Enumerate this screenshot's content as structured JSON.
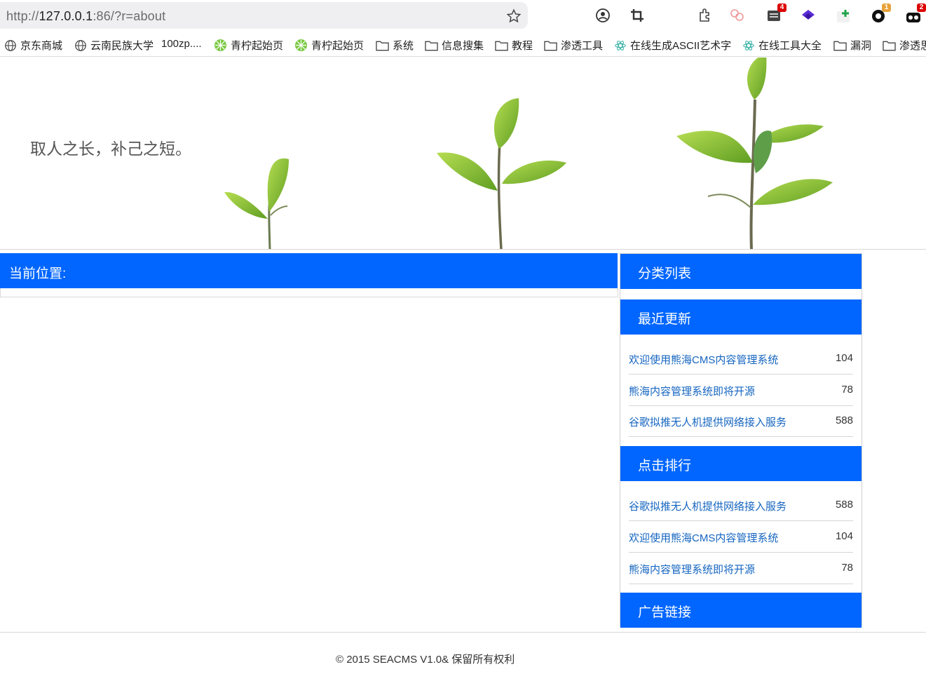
{
  "browser": {
    "url_scheme": "http://",
    "url_host": "127.0.0.1",
    "url_rest": ":86/?r=about",
    "extension_badges": [
      "4",
      "1",
      "2"
    ],
    "bookmarks": [
      "京东商城",
      "云南民族大学",
      "100zp....",
      "青柠起始页",
      "青柠起始页",
      "系统",
      "信息搜集",
      "教程",
      "渗透工具",
      "在线生成ASCII艺术字",
      "在线工具大全",
      "漏洞",
      "渗透思"
    ]
  },
  "banner": {
    "slogan": "取人之长，补己之短。"
  },
  "main": {
    "location_label": "当前位置:"
  },
  "sidebar": {
    "category_title": "分类列表",
    "recent_title": "最近更新",
    "recent": [
      {
        "title": "欢迎使用熊海CMS内容管理系统",
        "count": "104"
      },
      {
        "title": "熊海内容管理系统即将开源",
        "count": "78"
      },
      {
        "title": "谷歌拟推无人机提供网络接入服务",
        "count": "588"
      }
    ],
    "rank_title": "点击排行",
    "rank": [
      {
        "title": "谷歌拟推无人机提供网络接入服务",
        "count": "588"
      },
      {
        "title": "欢迎使用熊海CMS内容管理系统",
        "count": "104"
      },
      {
        "title": "熊海内容管理系统即将开源",
        "count": "78"
      }
    ],
    "ad_title": "广告链接"
  },
  "footer": {
    "text": "© 2015 SEACMS V1.0& 保留所有权利"
  },
  "colors": {
    "accent": "#0066ff",
    "link": "#1565c0"
  }
}
